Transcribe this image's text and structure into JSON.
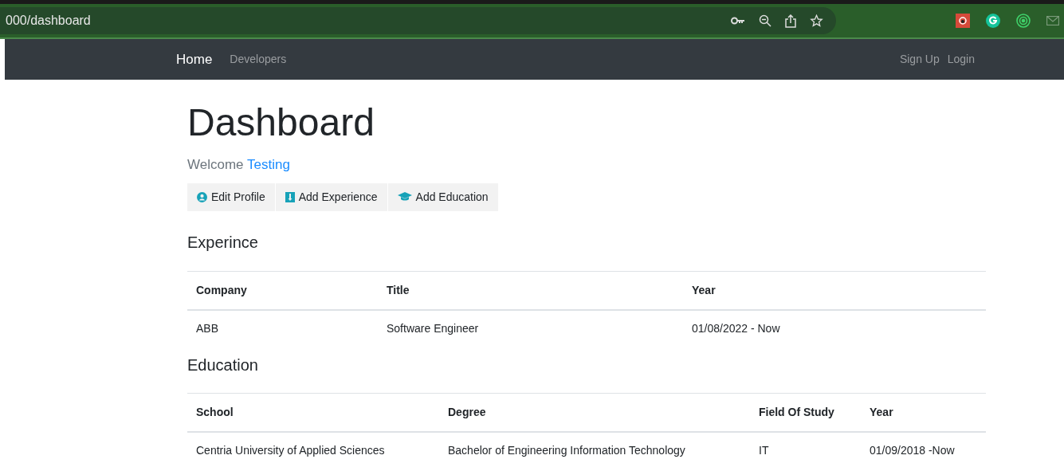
{
  "browser": {
    "url": "000/dashboard"
  },
  "navbar": {
    "brand": "Home",
    "links": [
      "Developers"
    ],
    "right_links": [
      "Sign Up",
      "Login"
    ]
  },
  "page": {
    "title": "Dashboard",
    "greeting": "Welcome",
    "user_name": "Testing"
  },
  "actions": [
    {
      "label": "Edit Profile",
      "kind": "profile"
    },
    {
      "label": "Add Experience",
      "kind": "experience"
    },
    {
      "label": "Add Education",
      "kind": "education"
    }
  ],
  "experience": {
    "heading": "Experince",
    "columns": [
      "Company",
      "Title",
      "Year"
    ],
    "rows": [
      [
        "ABB",
        "Software Engineer",
        "01/08/2022 - Now"
      ]
    ]
  },
  "education": {
    "heading": "Education",
    "columns": [
      "School",
      "Degree",
      "Field Of Study",
      "Year"
    ],
    "rows": [
      [
        "Centria University of Applied Sciences",
        "Bachelor of Engineering Information Technology",
        "IT",
        "01/09/2018 -Now"
      ]
    ]
  }
}
